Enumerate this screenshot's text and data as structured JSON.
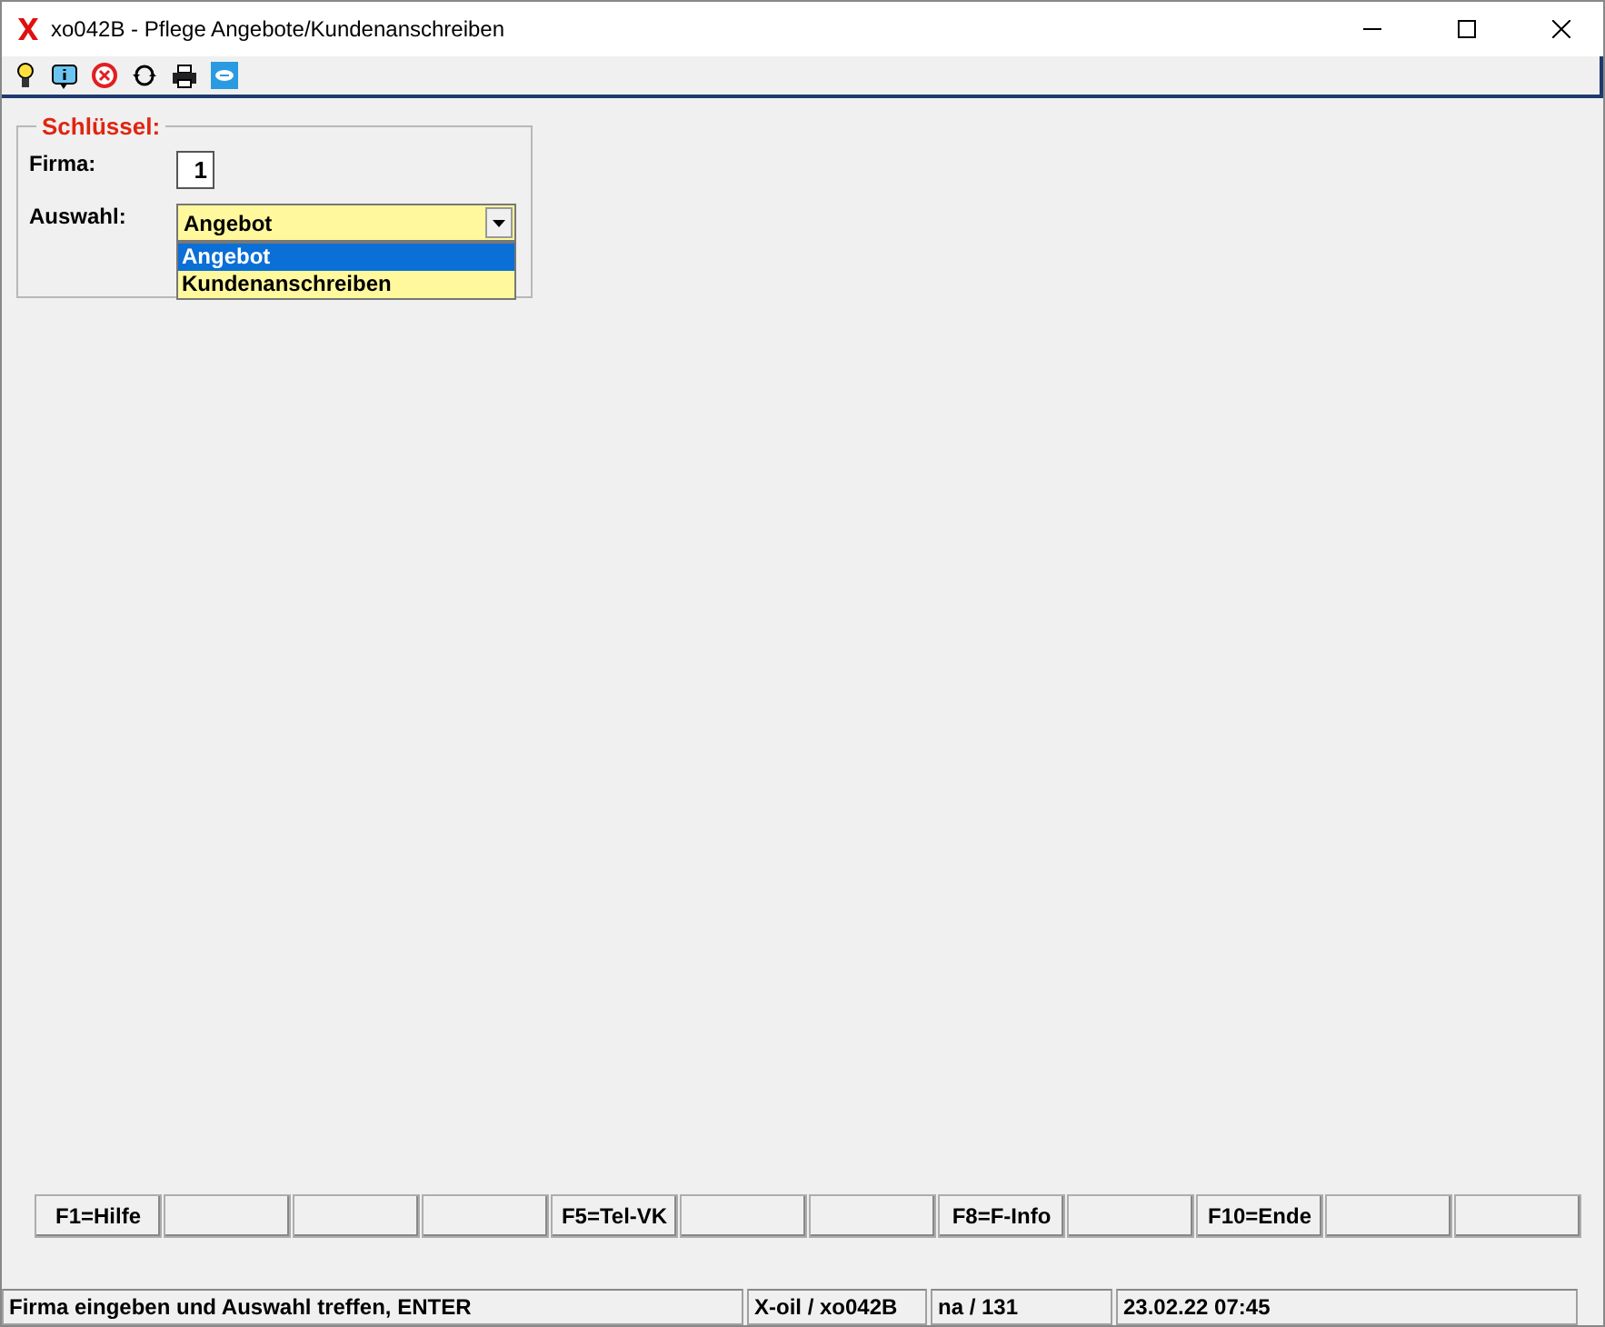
{
  "window": {
    "title": "xo042B - Pflege Angebote/Kundenanschreiben"
  },
  "group": {
    "title": "Schlüssel:"
  },
  "fields": [
    {
      "label": "Firma:",
      "value": "1"
    }
  ],
  "select": {
    "label": "Auswahl:",
    "value": "Angebot",
    "expanded": true,
    "options": [
      {
        "label": "Angebot",
        "selected": true
      },
      {
        "label": "Kundenanschreiben",
        "selected": false
      }
    ]
  },
  "function_keys": [
    {
      "kind": "key",
      "label": "F1=Hilfe"
    },
    {
      "kind": "blank"
    },
    {
      "kind": "blank"
    },
    {
      "kind": "blank"
    },
    {
      "kind": "key",
      "label": "F5=Tel-VK"
    },
    {
      "kind": "blank"
    },
    {
      "kind": "blank"
    },
    {
      "kind": "key",
      "label": "F8=F-Info"
    },
    {
      "kind": "blank"
    },
    {
      "kind": "key",
      "label": "F10=Ende"
    },
    {
      "kind": "blank"
    },
    {
      "kind": "blank"
    }
  ],
  "status_bar": [
    "Firma eingeben und Auswahl treffen, ENTER",
    "X-oil / xo042B",
    "na / 131",
    "23.02.22 07:45"
  ]
}
